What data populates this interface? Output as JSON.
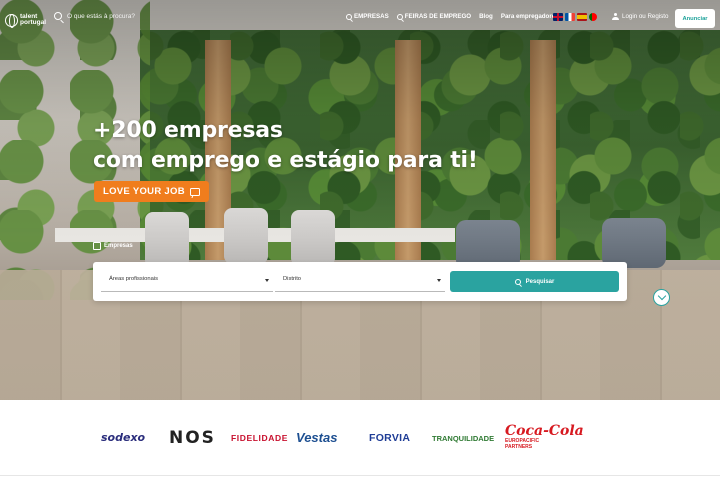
{
  "nav": {
    "logo_line1": "talent",
    "logo_line2": "portugal",
    "search_placeholder": "O que estás à procura?",
    "links": {
      "empresas": "EMPRESAS",
      "feiras": "FEIRAS DE EMPREGO",
      "blog": "Blog",
      "empregadores": "Para empregadores"
    },
    "login_label": "Login ou Registo",
    "cta_label": "Anunciar"
  },
  "hero": {
    "headline_line1": "+200 empresas",
    "headline_line2": "com emprego e estágio para ti!",
    "badge_label": "LOVE YOUR JOB"
  },
  "search_panel": {
    "tab_label": "Empresas",
    "areas_label": "Áreas profissionais",
    "distrito_label": "Distrito",
    "search_button": "Pesquisar"
  },
  "brands": {
    "sodexo": "sodexo",
    "nos": "NOS",
    "fidelidade": "FIDELIDADE",
    "vestas": "Vestas",
    "forvia": "FORVIA",
    "tranquilidade": "TRANQUILIDADE",
    "coca_script": "Coca-Cola",
    "coca_line1": "EUROPACIFIC",
    "coca_line2": "PARTNERS"
  },
  "colors": {
    "accent_teal": "#2aa3a0",
    "badge_orange": "#f07d1d"
  },
  "icons": [
    "globe-icon",
    "search-icon",
    "user-icon",
    "chat-icon",
    "building-icon",
    "chevron-down-icon"
  ]
}
